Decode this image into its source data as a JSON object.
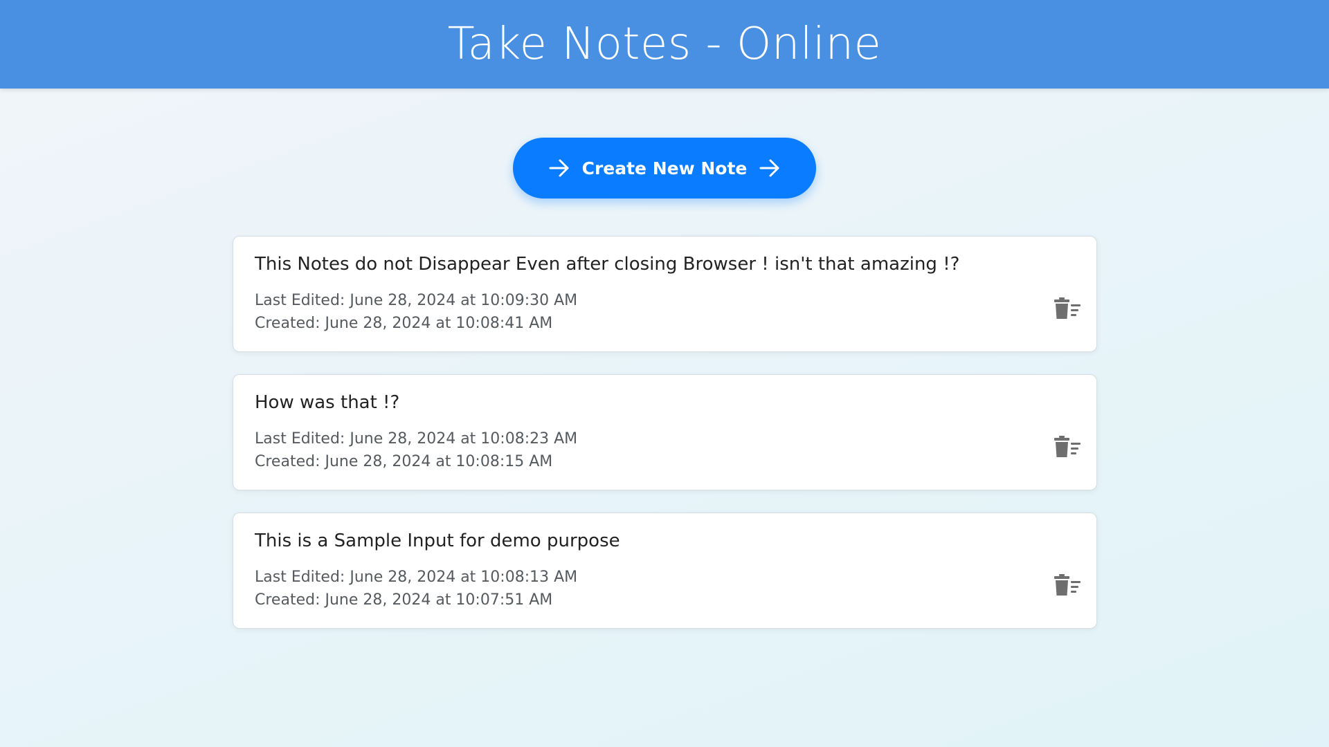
{
  "header": {
    "title": "Take Notes - Online"
  },
  "create_button": {
    "label": "Create New Note",
    "icon": "arrow-right-icon"
  },
  "colors": {
    "header_bg": "#4a90e2",
    "button_bg": "#0a7cff",
    "icon_gray": "#6e6e6e"
  },
  "notes": [
    {
      "text": "This Notes do not Disappear Even after closing Browser ! isn't that amazing !?",
      "last_edited": "Last Edited: June 28, 2024 at 10:09:30 AM",
      "created": "Created: June 28, 2024 at 10:08:41 AM",
      "delete_icon": "trash-icon"
    },
    {
      "text": "How was that !?",
      "last_edited": "Last Edited: June 28, 2024 at 10:08:23 AM",
      "created": "Created: June 28, 2024 at 10:08:15 AM",
      "delete_icon": "trash-icon"
    },
    {
      "text": "This is a Sample Input for demo purpose",
      "last_edited": "Last Edited: June 28, 2024 at 10:08:13 AM",
      "created": "Created: June 28, 2024 at 10:07:51 AM",
      "delete_icon": "trash-icon"
    }
  ]
}
